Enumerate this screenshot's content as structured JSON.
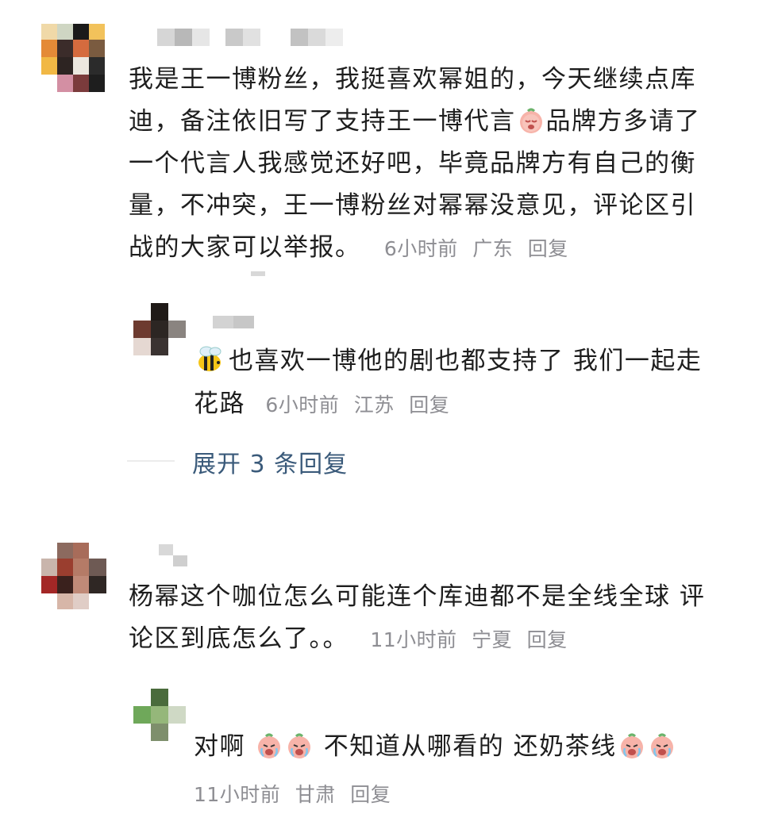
{
  "comments": [
    {
      "text_lines": [
        "我是王一博粉丝，我挺喜欢幂姐的，今天继续点库",
        "迪，备注依旧写了支持王一博代言",
        "品牌方多请了",
        "一个代言人我感觉还好吧，毕竟品牌方有自己的衡",
        "量，不冲突，王一博粉丝对幂幂没意见，评论区引",
        "战的大家可以举报。"
      ],
      "time": "6小时前",
      "location": "广东",
      "reply_label": "回复",
      "reply": {
        "text_line1": "也喜欢一博他的剧也都支持了 我们一起走",
        "text_line2": "花路",
        "time": "6小时前",
        "location": "江苏",
        "reply_label": "回复"
      },
      "expand_label": "展开 3 条回复"
    },
    {
      "text_lines": [
        "杨幂这个咖位怎么可能连个库迪都不是全线全球 评",
        "论区到底怎么了。。"
      ],
      "time": "11小时前",
      "location": "宁夏",
      "reply_label": "回复",
      "reply": {
        "text_part1": "对啊",
        "text_part2": "不知道从哪看的 还奶茶线",
        "time": "11小时前",
        "location": "甘肃",
        "reply_label": "回复"
      }
    }
  ],
  "icons": {
    "peach": "crying-peach-emoji",
    "bee": "bee-emoji"
  },
  "colors": {
    "text": "#1e1e1e",
    "meta": "#8e8e93",
    "link": "#3a5a7a"
  }
}
